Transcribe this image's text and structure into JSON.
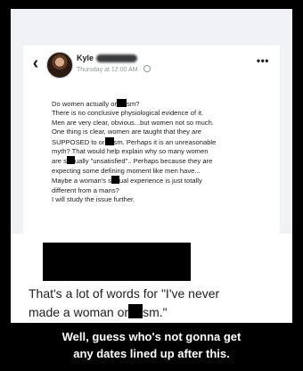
{
  "post": {
    "author": "Kyle",
    "timestamp": "Thursday at 12:00 AM ·",
    "body": [
      {
        "a": "Do women actually or",
        "b": "sm?"
      },
      {
        "a": "There is no conclusive physiological evidence of it."
      },
      {
        "a": "Men are very clear, obvious...but women not so much."
      },
      {
        "a": "One thing is clear, women are taught that they are"
      },
      {
        "a": "SUPPOSED to or",
        "b": "sm.  Perhaps it is an unreasonable"
      },
      {
        "a": "myth? That would help explain why so many women"
      },
      {
        "a": "are s",
        "b": "ually \"unsatisfied\".. Perhaps because they are"
      },
      {
        "a": "expecting some defining moment like men have..."
      },
      {
        "a": "Maybe a woman's s",
        "b": "ual experience is just totally"
      },
      {
        "a": "different from a mans?"
      },
      {
        "a": "I will study the issue further."
      }
    ]
  },
  "comment": {
    "line1": "That's a lot of words for \"I've never",
    "line2a": "made a woman or",
    "line2b": "sm.\""
  },
  "caption": {
    "line1": "Well, guess who's not gonna get",
    "line2": "any dates lined up after this."
  },
  "icons": {
    "back": "back-chevron-icon",
    "more": "more-options-icon",
    "audience": "globe-icon"
  }
}
